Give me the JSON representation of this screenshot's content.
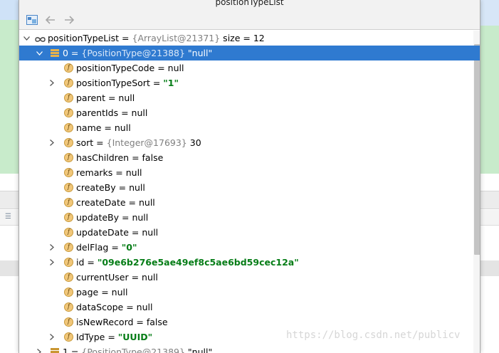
{
  "window": {
    "title": "positionTypeList"
  },
  "toolbar": {
    "buttons": [
      "layout-icon",
      "back-arrow-icon",
      "forward-arrow-icon"
    ]
  },
  "tree": {
    "root": {
      "name": "positionTypeList",
      "eq": " = ",
      "ref": "{ArrayList@21371}",
      "extra": "  size = 12"
    },
    "item0": {
      "name": "0",
      "eq": " = ",
      "ref": "{PositionType@21388}",
      "value": " \"null\""
    },
    "fields": [
      {
        "name": "positionTypeCode",
        "eq": " = ",
        "value": "null",
        "kind": "plain",
        "expandable": false
      },
      {
        "name": "positionTypeSort",
        "eq": " = ",
        "value": "\"1\"",
        "kind": "string",
        "expandable": true
      },
      {
        "name": "parent",
        "eq": " = ",
        "value": "null",
        "kind": "plain",
        "expandable": false
      },
      {
        "name": "parentIds",
        "eq": " = ",
        "value": "null",
        "kind": "plain",
        "expandable": false
      },
      {
        "name": "name",
        "eq": " = ",
        "value": "null",
        "kind": "plain",
        "expandable": false
      },
      {
        "name": "sort",
        "eq": " = ",
        "ref": "{Integer@17693}",
        "value": " 30",
        "kind": "ref",
        "expandable": true
      },
      {
        "name": "hasChildren",
        "eq": " = ",
        "value": "false",
        "kind": "plain",
        "expandable": false
      },
      {
        "name": "remarks",
        "eq": " = ",
        "value": "null",
        "kind": "plain",
        "expandable": false
      },
      {
        "name": "createBy",
        "eq": " = ",
        "value": "null",
        "kind": "plain",
        "expandable": false
      },
      {
        "name": "createDate",
        "eq": " = ",
        "value": "null",
        "kind": "plain",
        "expandable": false
      },
      {
        "name": "updateBy",
        "eq": " = ",
        "value": "null",
        "kind": "plain",
        "expandable": false
      },
      {
        "name": "updateDate",
        "eq": " = ",
        "value": "null",
        "kind": "plain",
        "expandable": false
      },
      {
        "name": "delFlag",
        "eq": " = ",
        "value": "\"0\"",
        "kind": "string",
        "expandable": true
      },
      {
        "name": "id",
        "eq": " = ",
        "value": "\"09e6b276e5ae49ef8c5ae6bd59cec12a\"",
        "kind": "string",
        "expandable": true
      },
      {
        "name": "currentUser",
        "eq": " = ",
        "value": "null",
        "kind": "plain",
        "expandable": false
      },
      {
        "name": "page",
        "eq": " = ",
        "value": "null",
        "kind": "plain",
        "expandable": false
      },
      {
        "name": "dataScope",
        "eq": " = ",
        "value": "null",
        "kind": "plain",
        "expandable": false
      },
      {
        "name": "isNewRecord",
        "eq": " = ",
        "value": "false",
        "kind": "plain",
        "expandable": false
      },
      {
        "name": "IdType",
        "eq": " = ",
        "value": "\"UUID\"",
        "kind": "string",
        "expandable": true
      }
    ],
    "item1": {
      "name": "1",
      "eq": " = ",
      "ref": "{PositionType@21389}",
      "value": " \"null\""
    }
  },
  "watermark": "https://blog.csdn.net/publicv",
  "colors": {
    "selection": "#2f7ad0",
    "string_value": "#067d17",
    "ref_gray": "#7f7f7f",
    "field_icon": "#f1c77a"
  }
}
